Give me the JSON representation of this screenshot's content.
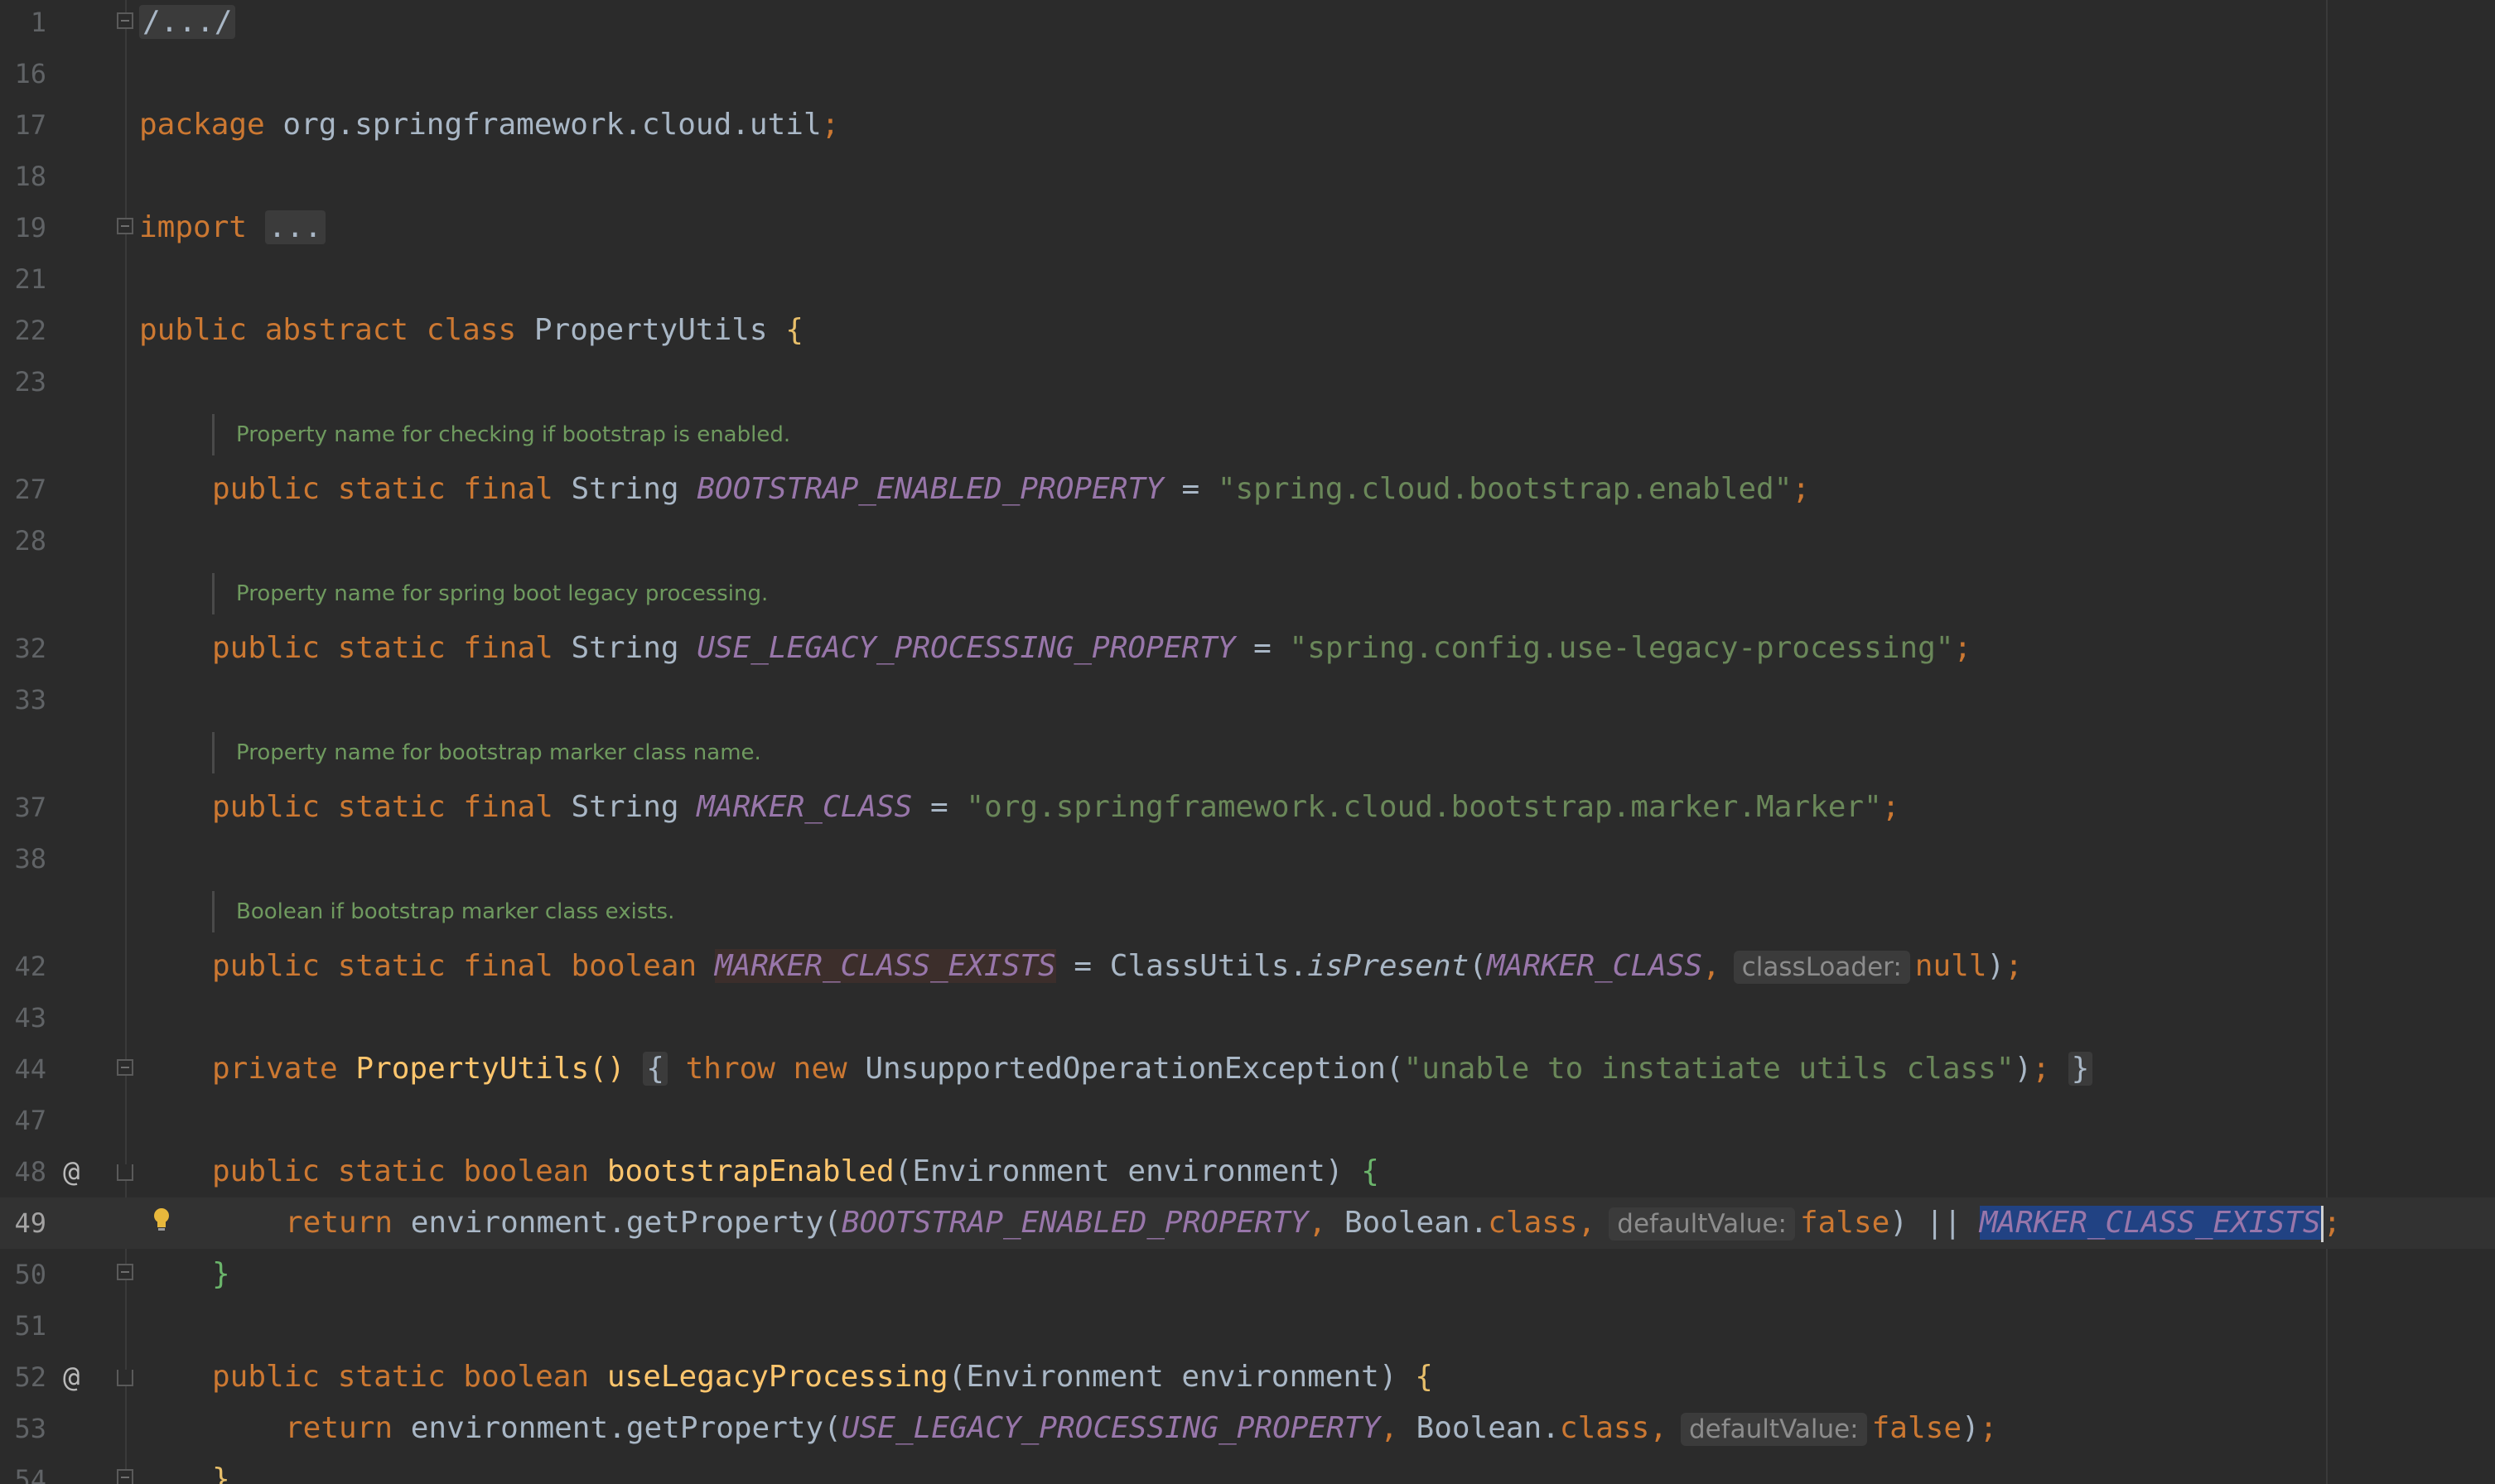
{
  "editor": {
    "language": "java",
    "colors": {
      "background": "#2b2b2b",
      "keyword": "#cc7832",
      "constant": "#9876aa",
      "string": "#6a8759",
      "method": "#ffc66d",
      "doc_comment": "#6f9a5f",
      "selection": "#214283"
    }
  },
  "lines": {
    "l1": "1",
    "l16": "16",
    "l17": "17",
    "l18": "18",
    "l19": "19",
    "l21": "21",
    "l22": "22",
    "l23": "23",
    "l27": "27",
    "l28": "28",
    "l32": "32",
    "l33": "33",
    "l37": "37",
    "l38": "38",
    "l42": "42",
    "l43": "43",
    "l44": "44",
    "l47": "47",
    "l48": "48",
    "l49": "49",
    "l50": "50",
    "l51": "51",
    "l52": "52",
    "l53": "53",
    "l54": "54"
  },
  "gutter": {
    "override_marker": "@",
    "icons": [
      "fold-icon",
      "at-icon",
      "bulb-icon"
    ]
  },
  "code": {
    "license_fold": "/.../",
    "package_kw": "package",
    "package_name": "org.springframework.cloud.util",
    "semicolon": ";",
    "import_kw": "import",
    "import_fold": "...",
    "class_mods": "public abstract class",
    "class_name": "PropertyUtils",
    "open_brace": "{",
    "close_brace": "}",
    "doc1": "Property name for checking if bootstrap is enabled.",
    "doc2": "Property name for spring boot legacy processing.",
    "doc3": "Property name for bootstrap marker class name.",
    "doc4": "Boolean if bootstrap marker class exists.",
    "psf": "public static final",
    "type_string": "String",
    "type_boolean": "boolean",
    "eq": "=",
    "c1_name": "BOOTSTRAP_ENABLED_PROPERTY",
    "c1_value": "\"spring.cloud.bootstrap.enabled\"",
    "c2_name": "USE_LEGACY_PROCESSING_PROPERTY",
    "c2_value": "\"spring.config.use-legacy-processing\"",
    "c3_name": "MARKER_CLASS",
    "c3_value": "\"org.springframework.cloud.bootstrap.marker.Marker\"",
    "c4_name": "MARKER_CLASS_EXISTS",
    "classutils": "ClassUtils.",
    "is_present": "isPresent",
    "hint_classloader": "classLoader:",
    "null_kw": "null",
    "private_kw": "private",
    "ctor_name": "PropertyUtils",
    "parens": "()",
    "throw_kw": "throw",
    "new_kw": "new",
    "exception": "UnsupportedOperationException",
    "exception_msg": "\"unable to instatiate utils class\"",
    "ps_boolean": "public static boolean",
    "m1_name": "bootstrapEnabled",
    "m2_name": "useLegacyProcessing",
    "param": "Environment environment",
    "return_kw": "return",
    "get_property": "environment.getProperty",
    "boolean_cls": "Boolean.",
    "class_kw": "class",
    "hint_default": "defaultValue:",
    "false_kw": "false",
    "or_op": "||"
  }
}
